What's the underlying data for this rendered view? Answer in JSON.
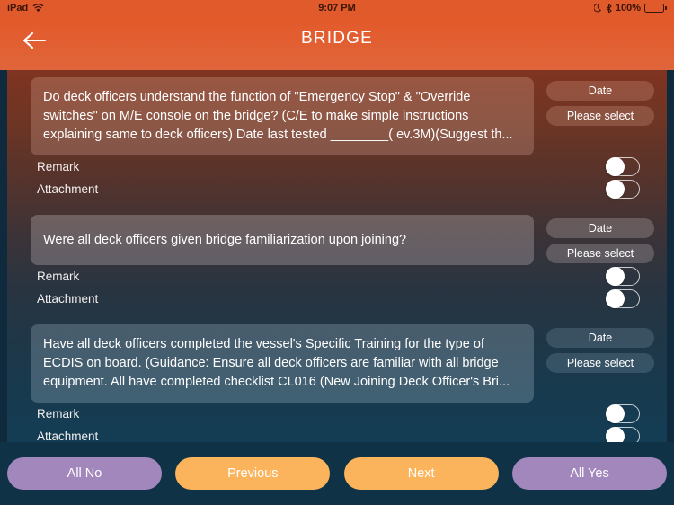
{
  "status_bar": {
    "device": "iPad",
    "wifi_icon": "wifi-icon",
    "time": "9:07 PM",
    "moon_icon": "moon-icon",
    "bluetooth_icon": "bluetooth-icon",
    "battery_percent": "100%",
    "battery_icon": "battery-icon",
    "battery_color": "#4cd964"
  },
  "nav": {
    "back_icon": "arrow-left-icon",
    "title": "BRIDGE"
  },
  "labels": {
    "remark": "Remark",
    "attachment": "Attachment",
    "date_button": "Date",
    "select_button": "Please select"
  },
  "questions": [
    {
      "text": "Do deck officers understand the function of \"Emergency Stop\" & \"Override switches\" on M/E console on the bridge? (C/E to make simple instructions explaining  same to deck officers) Date last tested ________( ev.3M)(Suggest th...",
      "date_label": "Date",
      "select_label": "Please select",
      "remark_label": "Remark",
      "attachment_label": "Attachment",
      "remark_on": false,
      "attachment_on": false
    },
    {
      "text": "Were all deck officers given bridge familiarization upon joining?",
      "date_label": "Date",
      "select_label": "Please select",
      "remark_label": "Remark",
      "attachment_label": "Attachment",
      "remark_on": false,
      "attachment_on": false
    },
    {
      "text": "Have all deck officers completed the vessel's Specific Training for the type of ECDIS on board. (Guidance: Ensure all deck officers are familiar with all bridge equipment. All have completed checklist CL016 (New Joining Deck Officer's Bri...",
      "date_label": "Date",
      "select_label": "Please select",
      "remark_label": "Remark",
      "attachment_label": "Attachment",
      "remark_on": false,
      "attachment_on": false
    }
  ],
  "bottom_bar": {
    "all_no": "All No",
    "previous": "Previous",
    "next": "Next",
    "all_yes": "All Yes",
    "purple": "#a287bd",
    "orange": "#fbb45c"
  }
}
